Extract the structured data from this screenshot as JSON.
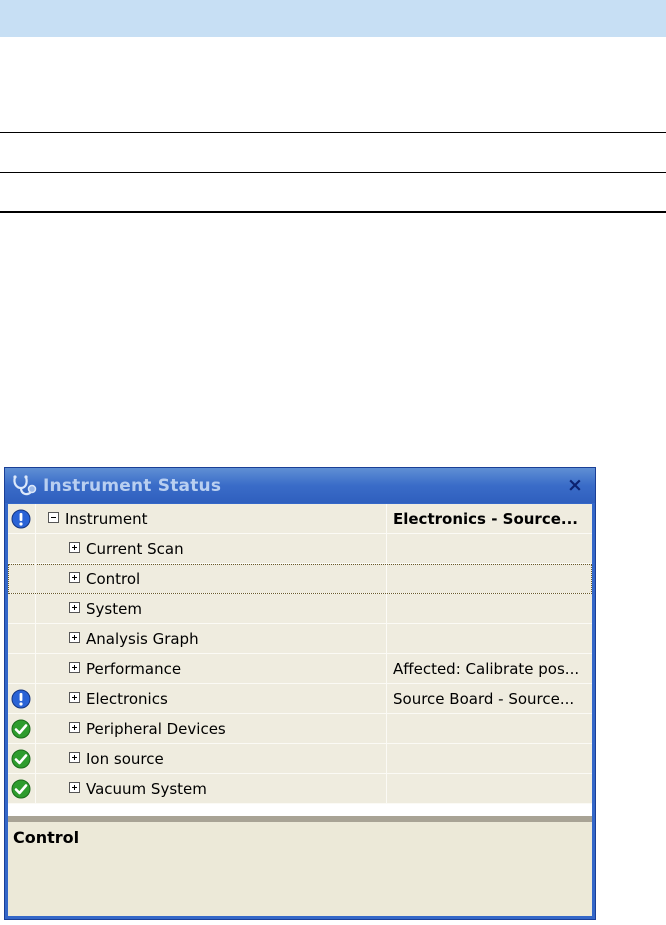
{
  "window": {
    "title": "Instrument Status",
    "close_label": "×"
  },
  "tree": {
    "rows": [
      {
        "name": "Instrument",
        "value": "Electronics - Source...",
        "status": "info",
        "expander": "minus"
      },
      {
        "name": "Current Scan",
        "value": "",
        "status": "none",
        "expander": "plus"
      },
      {
        "name": "Control",
        "value": "",
        "status": "none",
        "expander": "plus",
        "selected": true
      },
      {
        "name": "System",
        "value": "",
        "status": "none",
        "expander": "plus"
      },
      {
        "name": "Analysis Graph",
        "value": "",
        "status": "none",
        "expander": "plus"
      },
      {
        "name": "Performance",
        "value": "Affected: Calibrate pos...",
        "status": "none",
        "expander": "plus"
      },
      {
        "name": "Electronics",
        "value": "Source Board - Source...",
        "status": "info",
        "expander": "plus"
      },
      {
        "name": "Peripheral Devices",
        "value": "",
        "status": "ok",
        "expander": "plus"
      },
      {
        "name": "Ion source",
        "value": "",
        "status": "ok",
        "expander": "plus"
      },
      {
        "name": "Vacuum System",
        "value": "",
        "status": "ok",
        "expander": "plus"
      }
    ]
  },
  "detail": {
    "title": "Control"
  },
  "colors": {
    "info": "#2a63d6",
    "ok": "#2e9c2e",
    "titlebar": "#3a6cc8",
    "row_bg": "#efecdf"
  }
}
